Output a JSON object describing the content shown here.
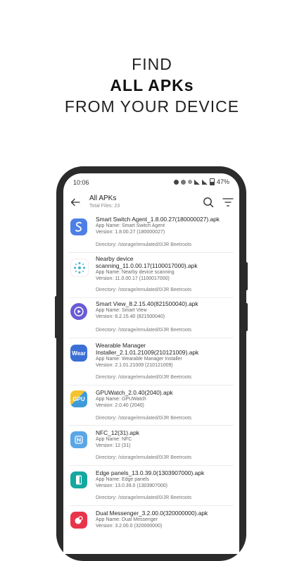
{
  "headline": {
    "line1": "FIND",
    "line2": "ALL APKs",
    "line3": "FROM YOUR DEVICE"
  },
  "status_bar": {
    "time": "10:06",
    "battery": "47%"
  },
  "app_bar": {
    "title": "All APKs",
    "subtitle": "Total Files: 23"
  },
  "colors": {
    "accent": "#3b6fd6",
    "phone_frame": "#2b2b2b"
  },
  "apks": [
    {
      "file": "Smart Switch Agent_1.8.00.27(180000027).apk",
      "app_name": "App Name: Smart Switch Agent",
      "version": "Version: 1.8.00.27 (180000027)",
      "directory": "Directory: /storage/emulated/0/JR Beetroots",
      "icon": "smart-switch-icon"
    },
    {
      "file": "Nearby device scanning_11.0.00.17(1100017000).apk",
      "app_name": "App Name: Nearby device scanning",
      "version": "Version: 11.0.00.17 (1100017000)",
      "directory": "Directory: /storage/emulated/0/JR Beetroots",
      "icon": "nearby-scan-icon"
    },
    {
      "file": "Smart View_8.2.15.40(821500040).apk",
      "app_name": "App Name: Smart View",
      "version": "Version: 8.2.15.40 (821500040)",
      "directory": "Directory: /storage/emulated/0/JR Beetroots",
      "icon": "smart-view-icon"
    },
    {
      "file": "Wearable Manager Installer_2.1.01.21009(210121009).apk",
      "app_name": "App Name: Wearable Manager Installer",
      "version": "Version: 2.1.01.21009 (210121009)",
      "directory": "Directory: /storage/emulated/0/JR Beetroots",
      "icon": "wear-icon",
      "icon_text": "Wear"
    },
    {
      "file": "GPUWatch_2.0.40(2040).apk",
      "app_name": "App Name: GPUWatch",
      "version": "Version: 2.0.40 (2040)",
      "directory": "Directory: /storage/emulated/0/JR Beetroots",
      "icon": "gpu-watch-icon",
      "icon_text": "GPU"
    },
    {
      "file": "NFC_12(31).apk",
      "app_name": "App Name: NFC",
      "version": "Version: 12 (31)",
      "directory": "Directory: /storage/emulated/0/JR Beetroots",
      "icon": "nfc-icon"
    },
    {
      "file": "Edge panels_13.0.39.0(1303907000).apk",
      "app_name": "App Name: Edge panels",
      "version": "Version: 13.0.39.0 (1303907000)",
      "directory": "Directory: /storage/emulated/0/JR Beetroots",
      "icon": "edge-panels-icon"
    },
    {
      "file": "Dual Messenger_3.2.00.0(320000000).apk",
      "app_name": "App Name: Dual Messenger",
      "version": "Version: 3.2.00.0 (320000000)",
      "directory": "",
      "icon": "dual-messenger-icon"
    }
  ]
}
